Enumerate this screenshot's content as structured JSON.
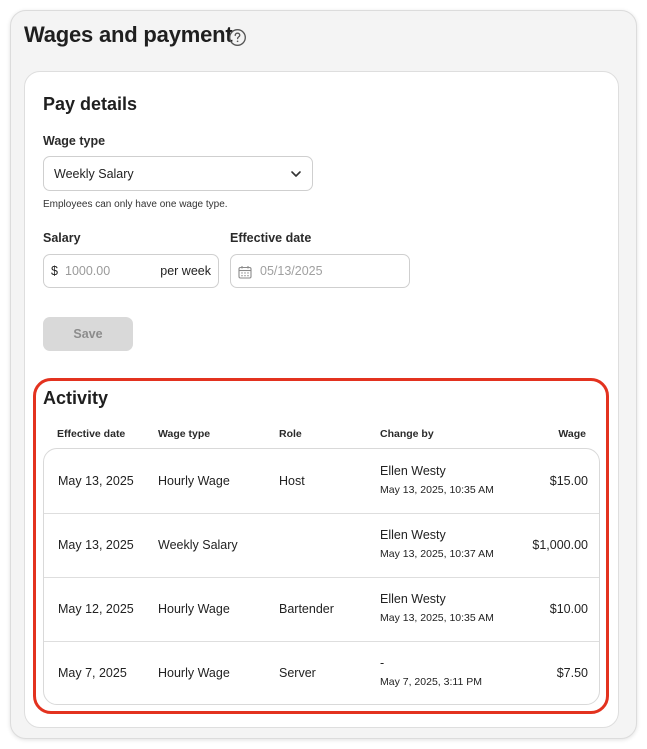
{
  "header": {
    "title": "Wages and payment",
    "help_icon": "question-circle-icon"
  },
  "pay_details": {
    "title": "Pay details",
    "wage_type_label": "Wage type",
    "wage_type_value": "Weekly Salary",
    "wage_type_helper": "Employees can only have one wage type.",
    "salary_label": "Salary",
    "currency_symbol": "$",
    "salary_placeholder": "1000.00",
    "salary_unit": "per week",
    "effective_date_label": "Effective date",
    "effective_date_placeholder": "05/13/2025",
    "save_label": "Save"
  },
  "activity": {
    "title": "Activity",
    "columns": [
      "Effective date",
      "Wage type",
      "Role",
      "Change by",
      "Wage"
    ],
    "rows": [
      {
        "effective_date": "May 13, 2025",
        "wage_type": "Hourly Wage",
        "role": "Host",
        "changed_by": "Ellen Westy",
        "changed_at": "May 13, 2025, 10:35 AM",
        "wage": "$15.00"
      },
      {
        "effective_date": "May 13, 2025",
        "wage_type": "Weekly Salary",
        "role": "",
        "changed_by": "Ellen Westy",
        "changed_at": "May 13, 2025, 10:37 AM",
        "wage": "$1,000.00"
      },
      {
        "effective_date": "May 12, 2025",
        "wage_type": "Hourly Wage",
        "role": "Bartender",
        "changed_by": "Ellen Westy",
        "changed_at": "May 13, 2025, 10:35 AM",
        "wage": "$10.00"
      },
      {
        "effective_date": "May 7, 2025",
        "wage_type": "Hourly Wage",
        "role": "Server",
        "changed_by": "-",
        "changed_at": "May 7, 2025, 3:11 PM",
        "wage": "$7.50"
      }
    ]
  },
  "colors": {
    "highlight": "#e3321f",
    "save_disabled_bg": "#d9d9d9",
    "panel_bg": "#f4f4f4"
  }
}
